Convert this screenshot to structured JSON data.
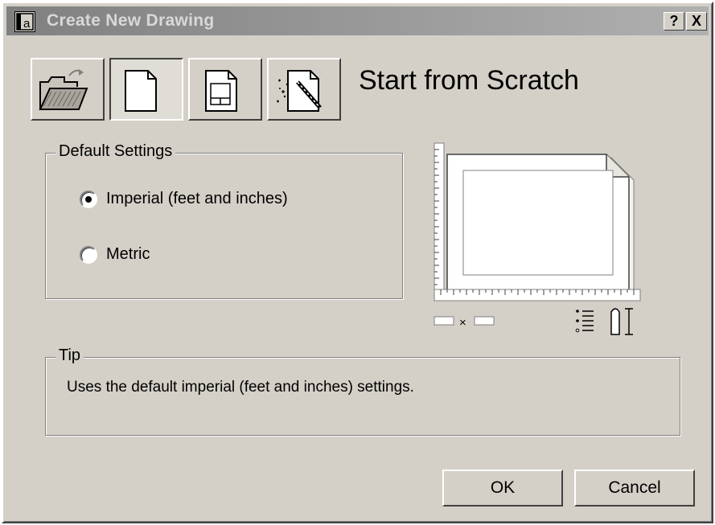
{
  "window": {
    "title": "Create New Drawing",
    "help_label": "?",
    "close_label": "X"
  },
  "options": [
    {
      "name": "open-drawing",
      "icon": "open-folder-icon",
      "selected": false
    },
    {
      "name": "start-from-scratch",
      "icon": "blank-page-icon",
      "selected": true
    },
    {
      "name": "use-template",
      "icon": "template-page-icon",
      "selected": false
    },
    {
      "name": "use-wizard",
      "icon": "wizard-icon",
      "selected": false
    }
  ],
  "page_heading": "Start from Scratch",
  "default_settings": {
    "label": "Default Settings",
    "imperial_label": "Imperial (feet and inches)",
    "metric_label": "Metric",
    "selected": "imperial"
  },
  "preview": {
    "times_symbol": "×"
  },
  "tip": {
    "label": "Tip",
    "text": "Uses the default imperial (feet and inches) settings."
  },
  "buttons": {
    "ok_label": "OK",
    "cancel_label": "Cancel"
  }
}
